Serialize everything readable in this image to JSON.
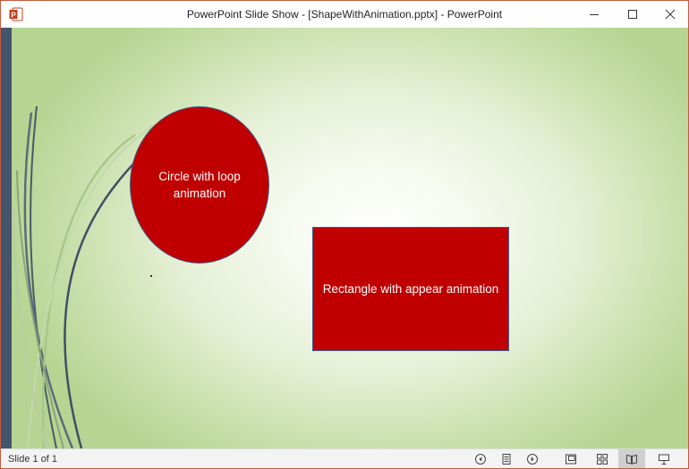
{
  "window": {
    "title": "PowerPoint Slide Show - [ShapeWithAnimation.pptx] - PowerPoint",
    "app_icon_letter": "P"
  },
  "window_controls": {
    "minimize_icon": "minimize-icon",
    "maximize_icon": "maximize-icon",
    "close_icon": "close-icon"
  },
  "slide": {
    "circle_text": "Circle with loop animation",
    "rectangle_text": "Rectangle with appear animation",
    "shape_fill": "#c00000",
    "accent_strip": "#44546a"
  },
  "statusbar": {
    "slide_counter": "Slide 1 of 1",
    "buttons": [
      "previous-icon",
      "menu-icon",
      "next-icon",
      "normal-view-icon",
      "slide-sorter-icon",
      "reading-view-icon",
      "slide-show-icon"
    ]
  }
}
